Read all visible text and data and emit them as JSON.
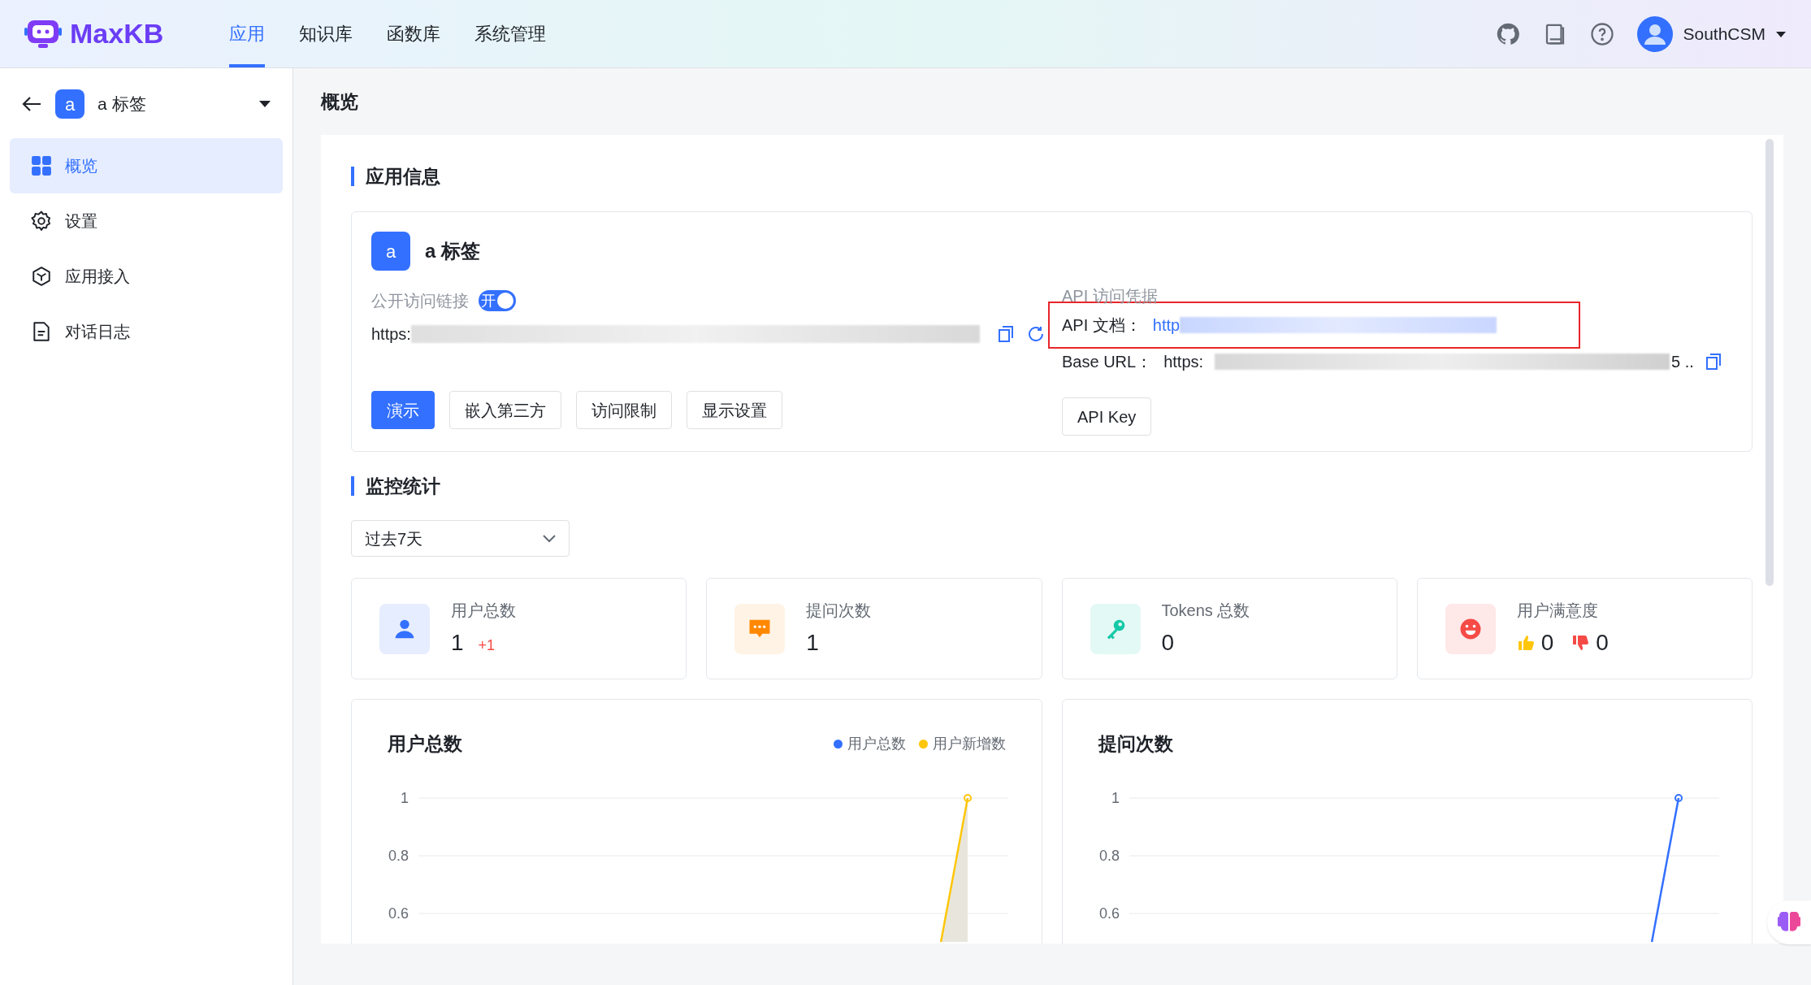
{
  "header": {
    "logo": "MaxKB",
    "nav": [
      {
        "label": "应用",
        "selected": true
      },
      {
        "label": "知识库",
        "selected": false
      },
      {
        "label": "函数库",
        "selected": false
      },
      {
        "label": "系统管理",
        "selected": false
      }
    ],
    "user": "SouthCSM"
  },
  "sidebar": {
    "app_avatar": "a",
    "app_name": "a 标签",
    "items": [
      {
        "label": "概览",
        "kind": "grid",
        "selected": true
      },
      {
        "label": "设置",
        "kind": "gear",
        "selected": false
      },
      {
        "label": "应用接入",
        "kind": "cube",
        "selected": false
      },
      {
        "label": "对话日志",
        "kind": "doc",
        "selected": false
      }
    ]
  },
  "page_title": "概览",
  "app_info": {
    "heading": "应用信息",
    "avatar": "a",
    "name": "a 标签",
    "public_link_label": "公开访问链接",
    "public_link_on": true,
    "toggle_text": "开",
    "public_link_url": "https:",
    "buttons": [
      {
        "label": "演示",
        "primary": true
      },
      {
        "label": "嵌入第三方",
        "primary": false
      },
      {
        "label": "访问限制",
        "primary": false
      },
      {
        "label": "显示设置",
        "primary": false
      }
    ],
    "api_label": "API 访问凭据",
    "api_doc_label": "API 文档：",
    "api_doc_url": "http",
    "base_url_label": "Base URL：",
    "base_url": "https:",
    "base_url_tail": "5 ..",
    "api_key_button": "API Key"
  },
  "monitor": {
    "heading": "监控统计",
    "range": "过去7天",
    "stats": [
      {
        "kind": "users",
        "label": "用户总数",
        "value": "1",
        "delta": "+1"
      },
      {
        "kind": "questions",
        "label": "提问次数",
        "value": "1"
      },
      {
        "kind": "tokens",
        "label": "Tokens 总数",
        "value": "0"
      },
      {
        "kind": "satisfaction",
        "label": "用户满意度",
        "likes": "0",
        "dislikes": "0"
      }
    ],
    "charts": [
      {
        "title": "用户总数",
        "axis_labels": [
          "1",
          "0.8",
          "0.6"
        ],
        "legend": [
          {
            "label": "用户总数",
            "color": "#3370ff"
          },
          {
            "label": "用户新增数",
            "color": "#ffc60a"
          }
        ]
      },
      {
        "title": "提问次数",
        "axis_labels": [
          "1",
          "0.8",
          "0.6"
        ]
      }
    ]
  }
}
